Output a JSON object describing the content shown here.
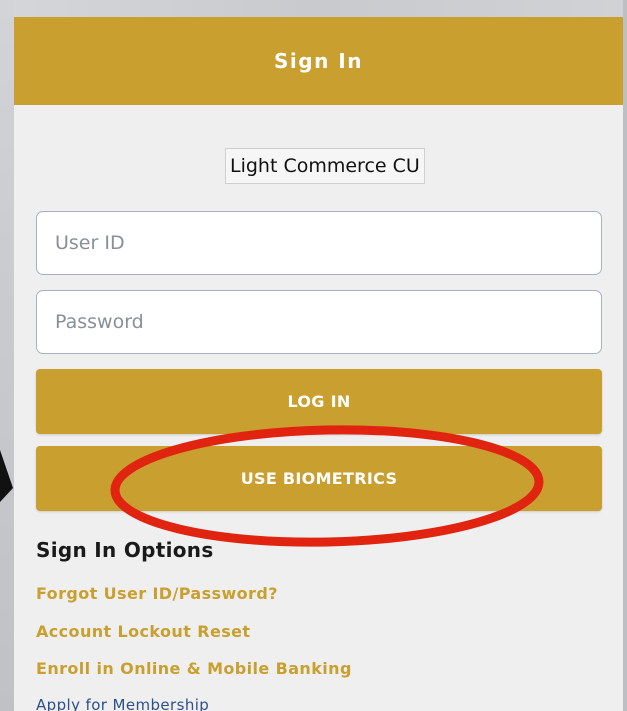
{
  "header": {
    "title": "Sign In"
  },
  "institution": {
    "name": "Light Commerce CU"
  },
  "form": {
    "user_id_placeholder": "User ID",
    "user_id_value": "",
    "password_placeholder": "Password",
    "password_value": ""
  },
  "buttons": {
    "login_label": "LOG IN",
    "biometrics_label": "USE BIOMETRICS"
  },
  "sign_in_options": {
    "heading": "Sign In Options",
    "links": [
      {
        "label": "Forgot User ID/Password?"
      },
      {
        "label": "Account Lockout Reset"
      },
      {
        "label": "Enroll in Online & Mobile Banking"
      },
      {
        "label": "Apply for Membership"
      }
    ]
  },
  "colors": {
    "brand_gold": "#c99f2f",
    "annotation_red": "#e0240f",
    "link_blue": "#2d4f8a"
  },
  "annotations": {
    "highlight": "red-oval-around-biometrics-button"
  }
}
